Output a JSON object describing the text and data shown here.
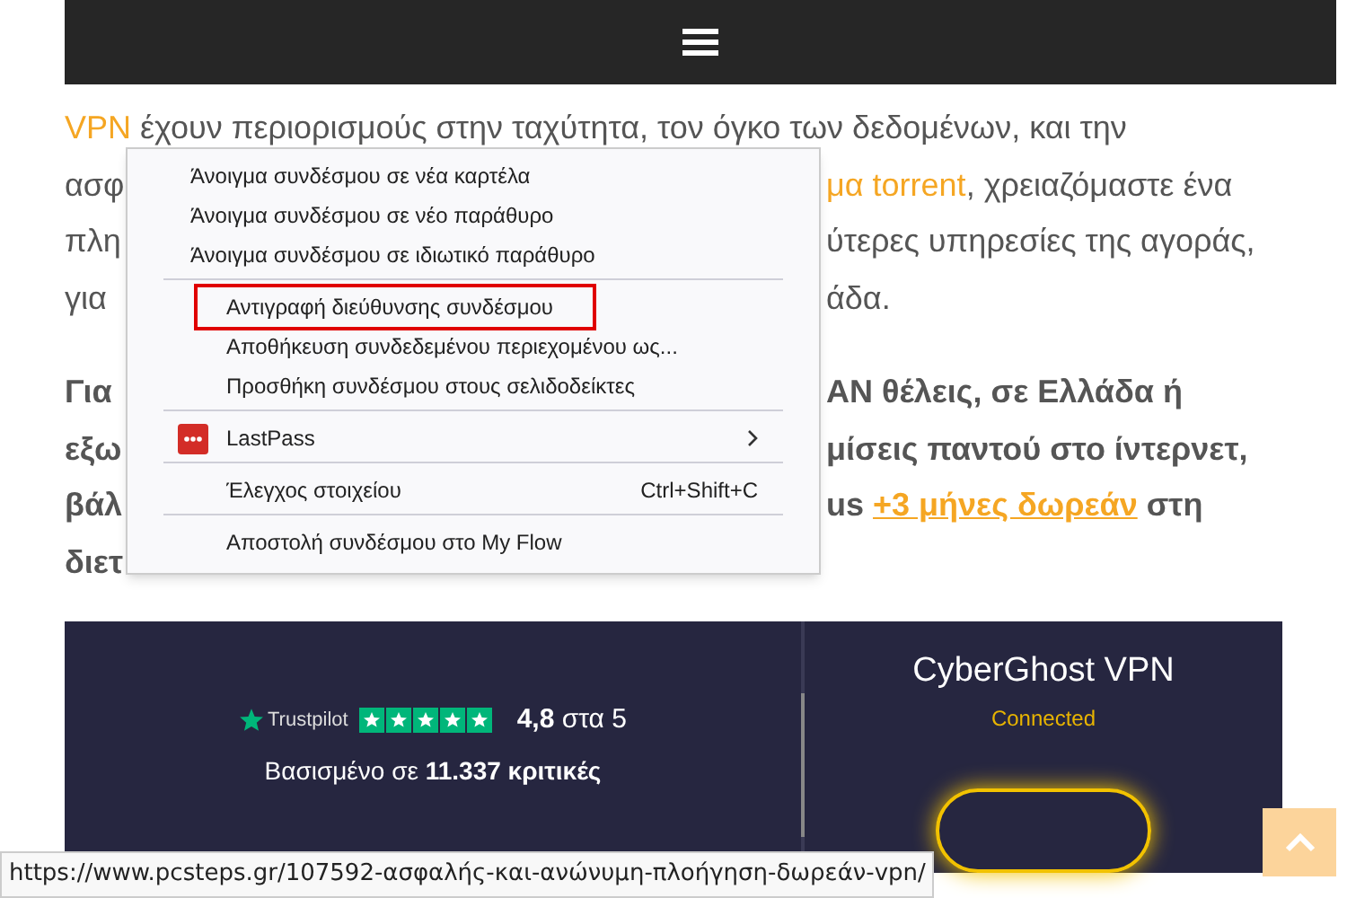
{
  "paragraphs": [
    {
      "kind": "normal",
      "lines": [
        {
          "left": [
            {
              "text": "VPN",
              "link": true
            },
            {
              "text": " έχουν περιορισμούς στην ταχύτητα, τον όγκο των δεδομένων, και την",
              "link": false
            }
          ]
        },
        {
          "left": [
            {
              "text": "ασφ",
              "link": false
            }
          ],
          "right": [
            {
              "text": "μα torrent",
              "link": true
            },
            {
              "text": ", χρειαζόμαστε ένα",
              "link": false
            }
          ]
        },
        {
          "left": [
            {
              "text": "πλη",
              "link": false
            }
          ],
          "right": [
            {
              "text": "ύτερες υπηρεσίες της αγοράς,",
              "link": false
            }
          ]
        },
        {
          "left": [
            {
              "text": "για",
              "link": false
            }
          ],
          "right": [
            {
              "text": "άδα.",
              "link": false
            }
          ]
        }
      ]
    },
    {
      "kind": "bold",
      "lines": [
        {
          "left": [
            {
              "text": "Για",
              "link": false
            }
          ],
          "right": [
            {
              "text": "AN θέλεις, σε Ελλάδα ή",
              "link": false
            }
          ]
        },
        {
          "left": [
            {
              "text": "εξω",
              "link": false
            }
          ],
          "right": [
            {
              "text": "μίσεις παντού στο ίντερνετ,",
              "link": false
            }
          ]
        },
        {
          "left": [
            {
              "text": "βάλ",
              "link": false
            }
          ],
          "right": [
            {
              "text": "us ",
              "link": false
            },
            {
              "text": "+3 μήνες δωρεάν",
              "link": true
            },
            {
              "text": " στη",
              "link": false
            }
          ]
        },
        {
          "left": [
            {
              "text": "διετ",
              "link": false
            }
          ]
        }
      ]
    }
  ],
  "context_menu": {
    "groups": [
      [
        {
          "kind": "command",
          "label": "Άνοιγμα συνδέσμου σε νέα καρτέλα",
          "highlighted": false
        },
        {
          "kind": "command",
          "label": "Άνοιγμα συνδέσμου σε νέο παράθυρο",
          "highlighted": false
        },
        {
          "kind": "command",
          "label": "Άνοιγμα συνδέσμου σε ιδιωτικό παράθυρο",
          "highlighted": false
        }
      ],
      [
        {
          "kind": "command",
          "label": "Αντιγραφή διεύθυνσης συνδέσμου",
          "highlighted": true
        },
        {
          "kind": "command",
          "label": "Αποθήκευση συνδεδεμένου περιεχομένου ως...",
          "highlighted": false
        },
        {
          "kind": "command",
          "label": "Προσθήκη συνδέσμου στους σελιδοδείκτες",
          "highlighted": false
        }
      ],
      [
        {
          "kind": "extension",
          "label": "LastPass",
          "submenu": true,
          "highlighted": false
        }
      ],
      [
        {
          "kind": "command",
          "label": "Έλεγχος στοιχείου",
          "shortcut": "Ctrl+Shift+C",
          "highlighted": false
        }
      ],
      [
        {
          "kind": "command",
          "label": "Αποστολή συνδέσμου στο My Flow",
          "highlighted": false
        }
      ]
    ]
  },
  "banner": {
    "trustpilot": {
      "brand": "Trustpilot",
      "stars": 5,
      "rating": "**4,8** στα 5",
      "reviews": "Βασισμένο σε **11.337 κριτικές**"
    },
    "app": {
      "title": "CyberGhost VPN",
      "status": "Connected"
    }
  },
  "status_bar": {
    "url": "https://www.pcsteps.gr/107592-ασφαλής-και-ανώνυμη-πλοήγηση-δωρεάν-vpn/"
  }
}
